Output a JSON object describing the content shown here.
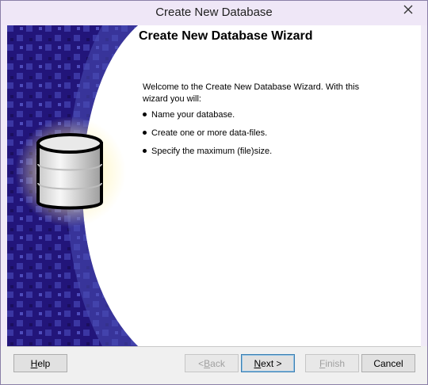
{
  "window": {
    "title": "Create New Database"
  },
  "wizard": {
    "heading": "Create New Database Wizard",
    "intro": "Welcome to the Create New Database Wizard. With this wizard you will:",
    "steps": [
      "Name your database.",
      "Create one or more data-files.",
      "Specify the maximum (file)size."
    ]
  },
  "buttons": {
    "help": {
      "pre": "",
      "key": "H",
      "post": "elp"
    },
    "back": {
      "pre": "< ",
      "key": "B",
      "post": "ack"
    },
    "next": {
      "pre": "",
      "key": "N",
      "post": "ext >"
    },
    "finish": {
      "pre": "",
      "key": "F",
      "post": "inish"
    },
    "cancel": {
      "pre": "Cancel",
      "key": "",
      "post": ""
    }
  },
  "icons": {
    "close": "close-icon",
    "database": "database-icon"
  },
  "colors": {
    "banner_dark": "#1a0d63",
    "banner_mid": "#2f2b8c",
    "accent": "#3c7fb1"
  }
}
